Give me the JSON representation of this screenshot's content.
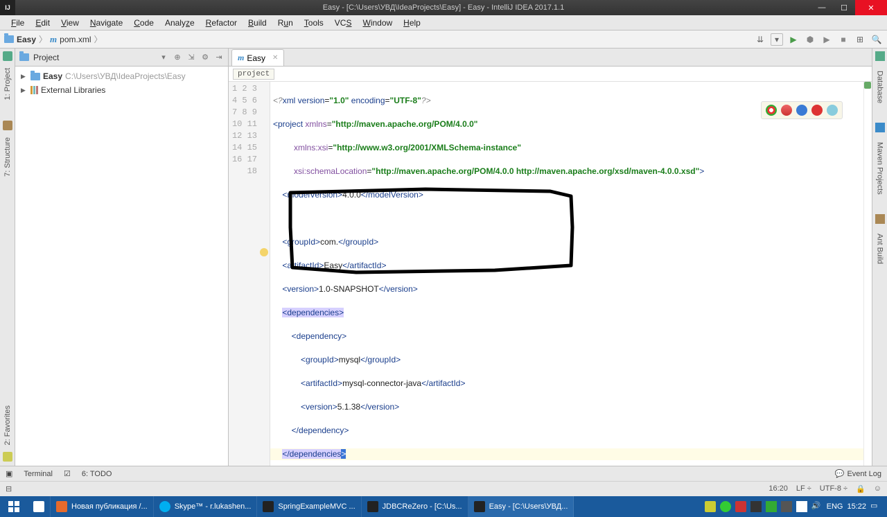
{
  "window": {
    "title": "Easy - [C:\\Users\\УВД\\IdeaProjects\\Easy] - Easy - IntelliJ IDEA 2017.1.1"
  },
  "menu": [
    "File",
    "Edit",
    "View",
    "Navigate",
    "Code",
    "Analyze",
    "Refactor",
    "Build",
    "Run",
    "Tools",
    "VCS",
    "Window",
    "Help"
  ],
  "crumbs": {
    "project": "Easy",
    "file": "pom.xml"
  },
  "project_panel": {
    "title": "Project",
    "root_name": "Easy",
    "root_path": "C:\\Users\\УВД\\IdeaProjects\\Easy",
    "ext_libs": "External Libraries"
  },
  "editor_tab": {
    "label": "Easy"
  },
  "breadcrumb_chip": "project",
  "code": {
    "l1": "<?xml version=\"1.0\" encoding=\"UTF-8\"?>",
    "l2_a": "<project ",
    "l2_attr": "xmlns",
    "l2_v": "\"http://maven.apache.org/POM/4.0.0\"",
    "l3_attr": "xmlns:xsi",
    "l3_v": "\"http://www.w3.org/2001/XMLSchema-instance\"",
    "l4_attr": "xsi:schemaLocation",
    "l4_v": "\"http://maven.apache.org/POM/4.0.0 http://maven.apache.org/xsd/maven-4.0.0.xsd\"",
    "modelVersion": "4.0.0",
    "groupId": "com.",
    "artifactId": "Easy",
    "version": "1.0-SNAPSHOT",
    "dep_groupId": "mysql",
    "dep_artifactId": "mysql-connector-java",
    "dep_version": "5.1.38"
  },
  "left_tools": [
    "1: Project",
    "7: Structure",
    "2: Favorites"
  ],
  "right_tools": [
    "Database",
    "Maven Projects",
    "Ant Build"
  ],
  "bottom_tools": {
    "terminal": "Terminal",
    "todo": "6: TODO",
    "eventlog": "Event Log"
  },
  "status": {
    "pos": "16:20",
    "sep": "LF ÷",
    "enc": "UTF-8 ÷"
  },
  "taskbar": {
    "items": [
      {
        "label": "Новая публикация /...",
        "color": "#e66a2c"
      },
      {
        "label": "Skype™ - r.lukashen...",
        "color": "#00aff0"
      },
      {
        "label": "SpringExampleMVC ...",
        "color": "#222"
      },
      {
        "label": "JDBCReZero - [C:\\Us...",
        "color": "#222"
      },
      {
        "label": "Easy - [C:\\Users\\УВД...",
        "color": "#222",
        "active": true
      }
    ],
    "lang": "ENG",
    "clock": "15:22"
  }
}
